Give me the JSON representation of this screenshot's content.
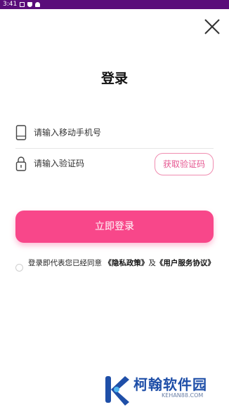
{
  "status_bar": {
    "time": "3:41"
  },
  "screen": {
    "title": "登录",
    "phone_input": {
      "placeholder": "请输入移动手机号",
      "value": ""
    },
    "code_input": {
      "placeholder": "请输入验证码",
      "value": ""
    },
    "get_code_label": "获取验证码",
    "login_label": "立即登录",
    "agreement": {
      "prefix": "登录即代表您已经同意 ",
      "privacy_link": "《隐私政策》",
      "joiner": "及",
      "service_link": "《用户服务协议》"
    }
  },
  "watermark": {
    "title": "柯翰软件园",
    "subtitle": "KEHAN88.COM"
  },
  "colors": {
    "accent": "#f8478a",
    "status_bar": "#5a0d7a",
    "watermark": "#1f4fa8"
  },
  "icons": {
    "close": "close-icon",
    "phone": "smartphone-icon",
    "lock": "lock-icon"
  }
}
